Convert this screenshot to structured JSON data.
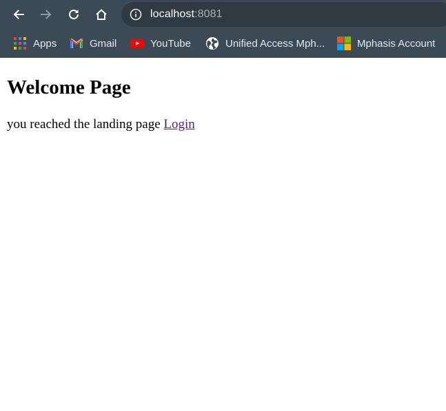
{
  "browser": {
    "url_host": "localhost",
    "url_port": ":8081",
    "colors": {
      "toolbar_bg": "#3c4a55",
      "omnibox_bg": "#2f3a43"
    }
  },
  "bookmarks": [
    {
      "label": "Apps",
      "icon": "apps-grid-icon"
    },
    {
      "label": "Gmail",
      "icon": "gmail-icon"
    },
    {
      "label": "YouTube",
      "icon": "youtube-icon"
    },
    {
      "label": "Unified Access Mph...",
      "icon": "globe-icon"
    },
    {
      "label": "Mphasis Account",
      "icon": "microsoft-icon"
    }
  ],
  "page": {
    "heading": "Welcome Page",
    "text": "you reached the landing page",
    "link_label": "Login",
    "link_color": "#551a8b"
  }
}
